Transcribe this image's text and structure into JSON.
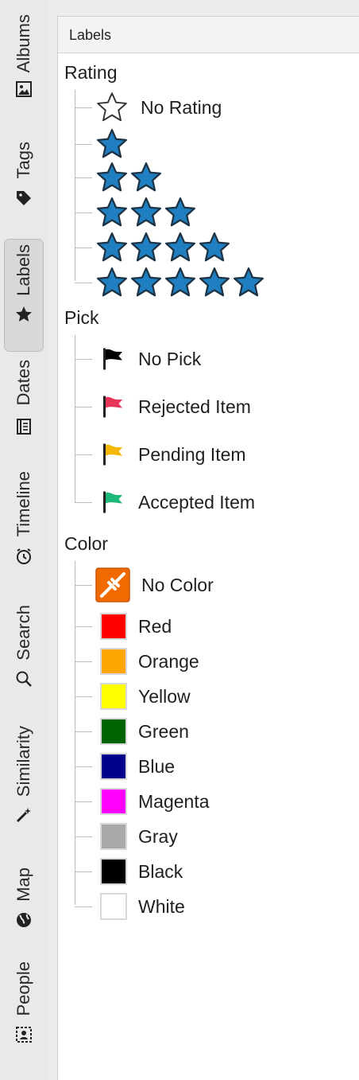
{
  "sidebar": {
    "tabs": [
      {
        "label": "Albums",
        "icon": "image-icon"
      },
      {
        "label": "Tags",
        "icon": "tag-icon"
      },
      {
        "label": "Labels",
        "icon": "star-icon",
        "active": true
      },
      {
        "label": "Dates",
        "icon": "calendar-icon"
      },
      {
        "label": "Timeline",
        "icon": "clock-icon"
      },
      {
        "label": "Search",
        "icon": "search-icon"
      },
      {
        "label": "Similarity",
        "icon": "magic-wand-icon"
      },
      {
        "label": "Map",
        "icon": "globe-icon"
      },
      {
        "label": "People",
        "icon": "face-icon"
      }
    ]
  },
  "panel": {
    "title": "Labels",
    "rating": {
      "title": "Rating",
      "items": [
        {
          "label": "No Rating",
          "stars": 0
        },
        {
          "stars": 1
        },
        {
          "stars": 2
        },
        {
          "stars": 3
        },
        {
          "stars": 4
        },
        {
          "stars": 5
        }
      ]
    },
    "pick": {
      "title": "Pick",
      "items": [
        {
          "label": "No Pick",
          "flag_color": "#000000"
        },
        {
          "label": "Rejected Item",
          "flag_color": "#e8365a"
        },
        {
          "label": "Pending Item",
          "flag_color": "#f5b800"
        },
        {
          "label": "Accepted Item",
          "flag_color": "#1db87a"
        }
      ]
    },
    "color": {
      "title": "Color",
      "items": [
        {
          "label": "No Color",
          "swatch": "none"
        },
        {
          "label": "Red",
          "swatch": "#ff0000"
        },
        {
          "label": "Orange",
          "swatch": "#ffa500"
        },
        {
          "label": "Yellow",
          "swatch": "#ffff00"
        },
        {
          "label": "Green",
          "swatch": "#006400"
        },
        {
          "label": "Blue",
          "swatch": "#00008b"
        },
        {
          "label": "Magenta",
          "swatch": "#ff00ff"
        },
        {
          "label": "Gray",
          "swatch": "#a9a9a9"
        },
        {
          "label": "Black",
          "swatch": "#000000"
        },
        {
          "label": "White",
          "swatch": "#ffffff"
        }
      ]
    }
  },
  "colors": {
    "star_fill": "#1f7fc0",
    "star_stroke": "#1d3344",
    "no_color_bg": "#f06a00"
  }
}
